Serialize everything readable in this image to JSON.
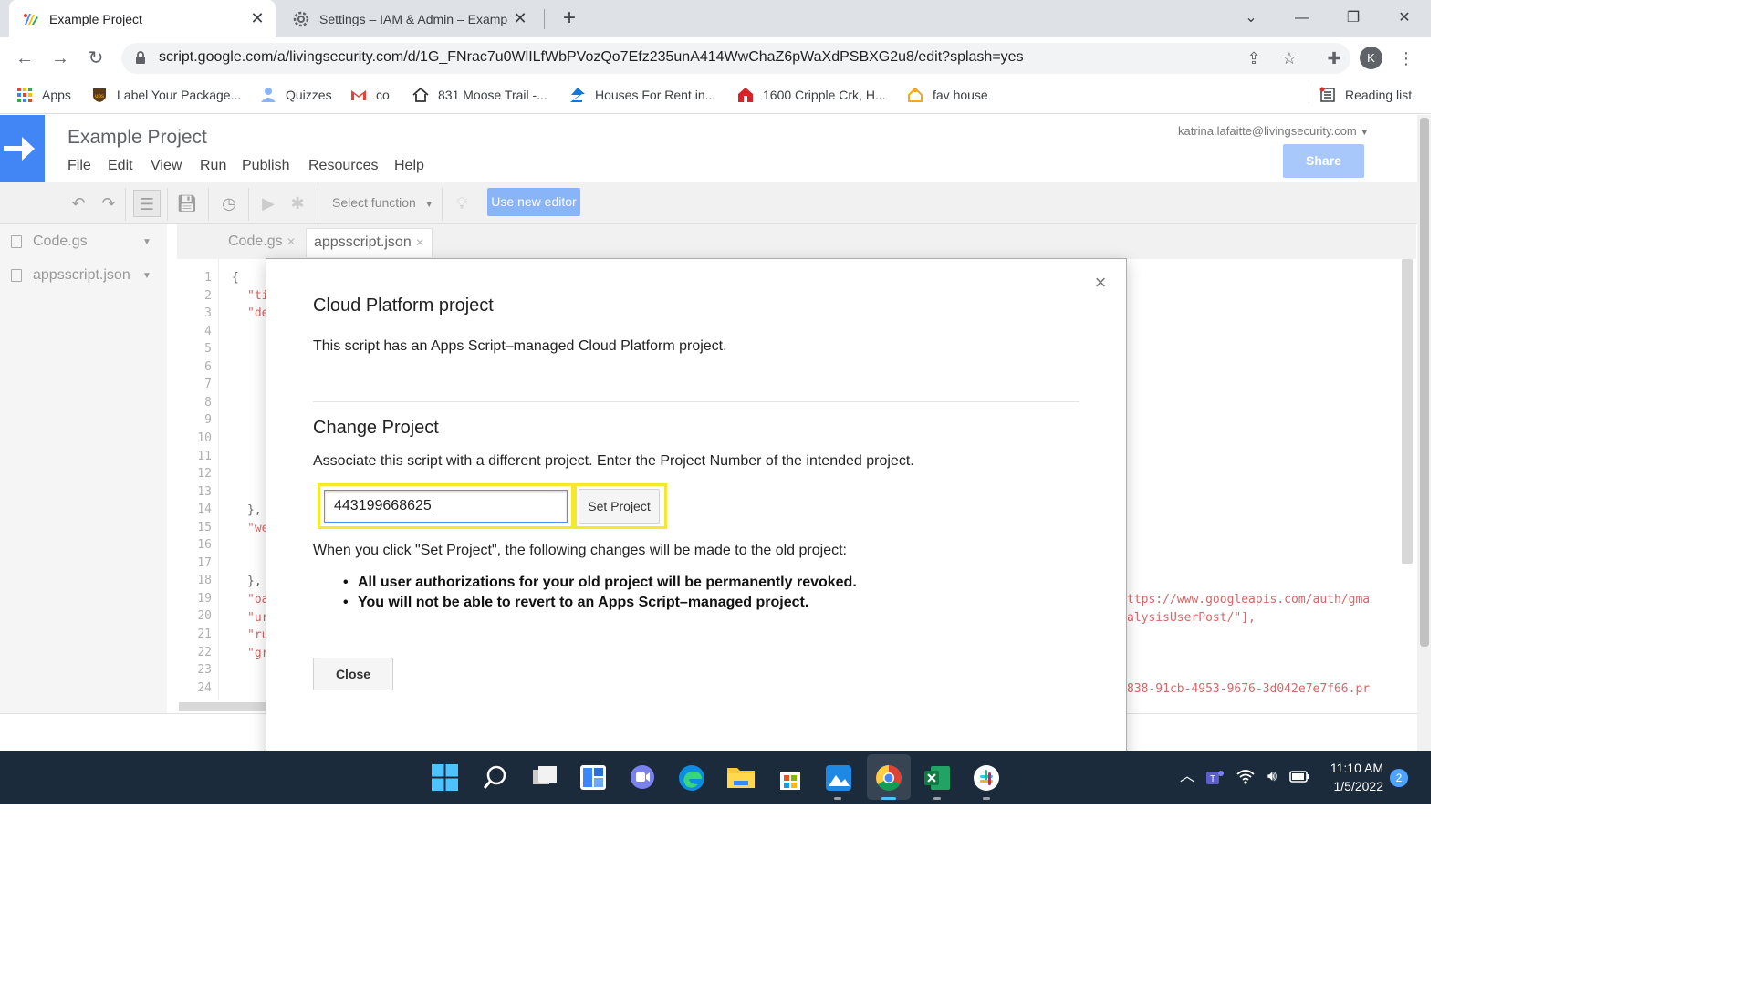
{
  "browser": {
    "tabs": [
      {
        "title": "Example Project",
        "active": true
      },
      {
        "title": "Settings – IAM & Admin – Examp",
        "active": false
      }
    ],
    "url": "script.google.com/a/livingsecurity.com/d/1G_FNrac7u0WlILfWbPVozQo7Efz235unA414WwChaZ6pWaXdPSBXG2u8/edit?splash=yes",
    "profile_initial": "K",
    "bookmarks": [
      "Apps",
      "Label Your Package...",
      "Quizzes",
      "co",
      "831 Moose Trail -...",
      "Houses For Rent in...",
      "1600 Cripple Crk, H...",
      "fav house"
    ],
    "reading_list": "Reading list"
  },
  "editor": {
    "project_title": "Example Project",
    "menu": [
      "File",
      "Edit",
      "View",
      "Run",
      "Publish",
      "Resources",
      "Help"
    ],
    "user_email": "katrina.lafaitte@livingsecurity.com",
    "share_label": "Share",
    "select_function": "Select function",
    "use_new_editor": "Use new editor",
    "files": [
      "Code.gs",
      "appsscript.json"
    ],
    "code_tabs": [
      "Code.gs",
      "appsscript.json"
    ],
    "line_numbers": [
      "1",
      "2",
      "3",
      "4",
      "5",
      "6",
      "7",
      "8",
      "9",
      "10",
      "11",
      "12",
      "13",
      "14",
      "15",
      "16",
      "17",
      "18",
      "19",
      "20",
      "21",
      "22",
      "23",
      "24"
    ],
    "code_fragments": {
      "l1": "{",
      "l2": "\"ti",
      "l3": "\"de",
      "l14": "},",
      "l15": "\"we",
      "l18": "},",
      "l19": "\"oa",
      "l20": "\"ur",
      "l21": "\"ru",
      "l22": "\"gr",
      "r19": "ttps://www.googleapis.com/auth/gma",
      "r20": "alysisUserPost/\"],",
      "r24": "838-91cb-4953-9676-3d042e7e7f66.pr"
    }
  },
  "dialog": {
    "title": "Cloud Platform project",
    "description": "This script has an Apps Script–managed Cloud Platform project.",
    "change_heading": "Change Project",
    "change_instructions": "Associate this script with a different project. Enter the Project Number of the intended project.",
    "project_number_value": "443199668625",
    "set_project_label": "Set Project",
    "warning_intro": "When you click \"Set Project\", the following changes will be made to the old project:",
    "warnings": [
      "All user authorizations for your old project will be permanently revoked.",
      "You will not be able to revert to an Apps Script–managed project."
    ],
    "close_label": "Close",
    "close_icon": "×"
  },
  "taskbar": {
    "time": "11:10 AM",
    "date": "1/5/2022",
    "notification_count": "2"
  },
  "colors": {
    "highlight": "#f4ea2a",
    "google_blue": "#4285f4",
    "taskbar": "#1b2b3c"
  }
}
